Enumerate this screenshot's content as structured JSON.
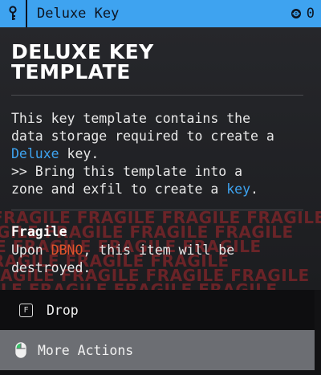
{
  "header": {
    "title": "Deluxe Key",
    "count": "0",
    "accent_color": "#3ea3f0",
    "leading_icon": "key-icon",
    "count_icon": "currency-icon"
  },
  "card": {
    "headline_line1": "DELUXE KEY",
    "headline_line2": "TEMPLATE",
    "desc_line1": "This key template contains the",
    "desc_line2": "data storage required to create a",
    "desc_deluxe": "Deluxe",
    "desc_line3_rest": " key.",
    "desc_line4": ">> Bring this template into a",
    "desc_line5_pre": "zone and exfil to create a ",
    "desc_key": "key",
    "desc_line5_post": "."
  },
  "fragile": {
    "watermark": "FRAGILE FRAGILE FRAGILE FRAGILE",
    "title": "Fragile",
    "desc_pre": "Upon ",
    "desc_dbno": "DBNO",
    "desc_post1": ", this item will be",
    "desc_line2": "destroyed.",
    "warn_color": "#e0542c"
  },
  "actions": {
    "drop_key": "F",
    "drop_label": "Drop",
    "more_label": "More Actions",
    "more_icon": "mouse-icon"
  }
}
